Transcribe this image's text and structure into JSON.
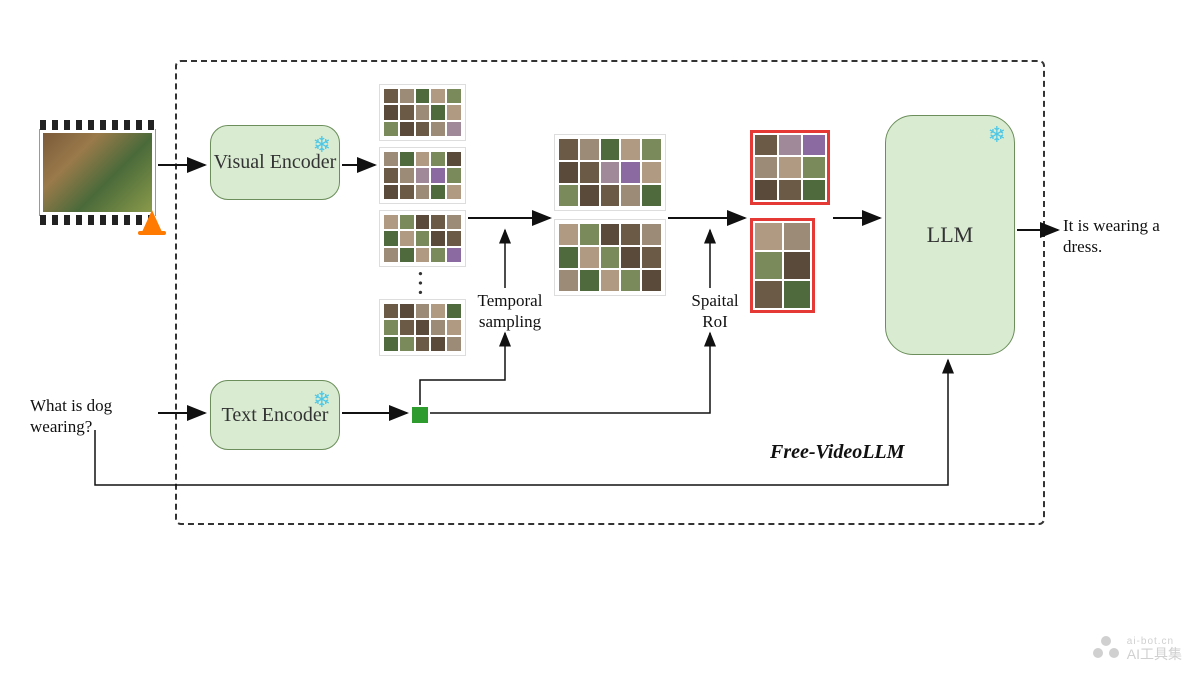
{
  "inputs": {
    "video_label": "",
    "question": "What is dog wearing?"
  },
  "blocks": {
    "visual_encoder": "Visual Encoder",
    "text_encoder": "Text Encoder",
    "llm": "LLM",
    "frozen_icon_name": "snowflake-icon"
  },
  "stages": {
    "temporal": "Temporal sampling",
    "spatial": "Spaital RoI"
  },
  "system_name": "Free-VideoLLM",
  "output": "It is wearing a dress.",
  "watermark": {
    "site": "ai-bot.cn",
    "brand": "AI工具集"
  },
  "colors": {
    "block_fill": "#d9ecd2",
    "block_border": "#6b8e5a",
    "roi_border": "#e53935",
    "token": "#2e9b2e",
    "snow": "#4ec7e6"
  }
}
